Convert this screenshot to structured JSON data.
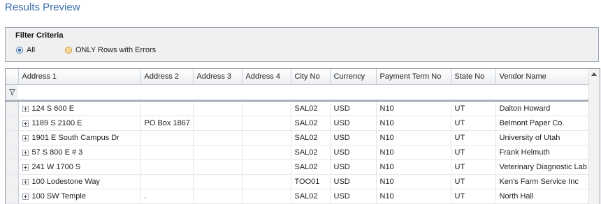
{
  "title": "Results Preview",
  "filter": {
    "heading": "Filter Criteria",
    "options": [
      {
        "label": "All",
        "selected": true
      },
      {
        "label": "ONLY Rows with Errors",
        "selected": false
      }
    ]
  },
  "grid": {
    "columns": [
      "Address 1",
      "Address 2",
      "Address 3",
      "Address 4",
      "City No",
      "Currency",
      "Payment Term No",
      "State No",
      "Vendor Name"
    ],
    "rows": [
      [
        "124 S 600 E",
        "",
        "",
        "",
        "SAL02",
        "USD",
        "N10",
        "UT",
        "Dalton Howard"
      ],
      [
        "1189 S 2100 E",
        "PO Box 1867",
        "",
        "",
        "SAL02",
        "USD",
        "N10",
        "UT",
        "Belmont Paper Co."
      ],
      [
        "1901 E South Campus Dr",
        "",
        "",
        "",
        "SAL02",
        "USD",
        "N10",
        "UT",
        "University of Utah"
      ],
      [
        "57 S 800 E # 3",
        "",
        "",
        "",
        "SAL02",
        "USD",
        "N10",
        "UT",
        "Frank Helmuth"
      ],
      [
        "241 W 1700 S",
        "",
        "",
        "",
        "SAL02",
        "USD",
        "N10",
        "UT",
        "Veterinary Diagnostic Lab"
      ],
      [
        "100 Lodestone Way",
        "",
        "",
        "",
        "TOO01",
        "USD",
        "N10",
        "UT",
        "Ken's Farm Service Inc"
      ],
      [
        "100 SW Temple",
        ".",
        "",
        "",
        "SAL02",
        "USD",
        "N10",
        "UT",
        "North Hall"
      ]
    ]
  },
  "icons": {
    "filter_row": "funnel-icon",
    "expand": "plus-box-icon",
    "scroll_up": "arrow-up-icon"
  },
  "colors": {
    "title": "#3a6fa8",
    "radio_selected": "#2d5f9c",
    "radio_unselected": "#f6d99a"
  }
}
